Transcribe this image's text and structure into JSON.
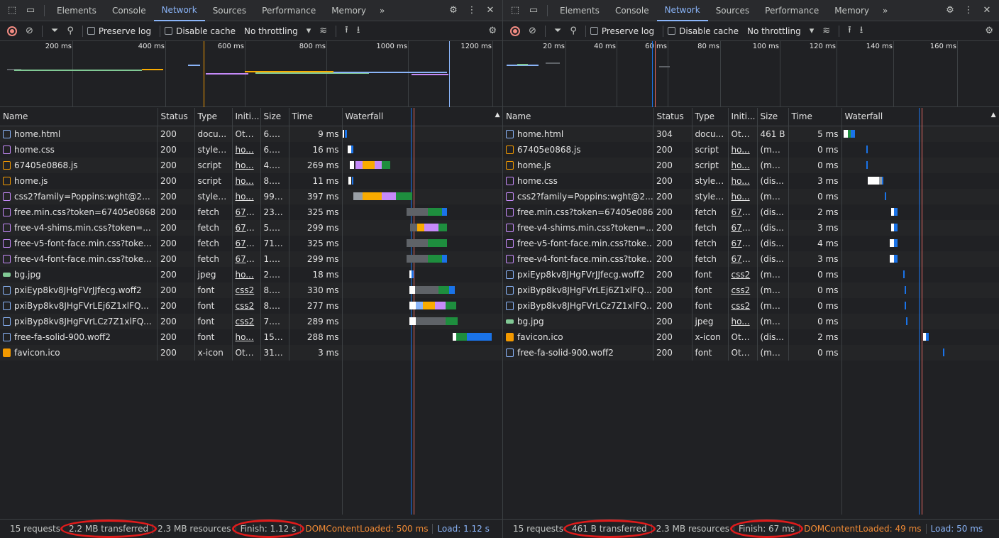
{
  "colors": {
    "accent": "#8ab4f8",
    "annotation": "#e01b1b",
    "dom_line": "#1a73e8",
    "load_line": "#e46962",
    "orange": "#f28b35"
  },
  "tabs": [
    "Elements",
    "Console",
    "Network",
    "Sources",
    "Performance",
    "Memory"
  ],
  "active_tab": "Network",
  "toolbar": {
    "preserve_log": "Preserve log",
    "disable_cache": "Disable cache",
    "throttling": "No throttling"
  },
  "columns": {
    "name": "Name",
    "status": "Status",
    "type": "Type",
    "initiator": "Initi...",
    "size": "Size",
    "time": "Time",
    "waterfall": "Waterfall"
  },
  "left": {
    "overview_ticks": [
      "200 ms",
      "400 ms",
      "600 ms",
      "800 ms",
      "1000 ms",
      "1200 ms"
    ],
    "rows": [
      {
        "name": "home.html",
        "icon": "document-icon",
        "status": "200",
        "type": "docu...",
        "initiator": "Other",
        "size": "6.3 ...",
        "time": "9 ms"
      },
      {
        "name": "home.css",
        "icon": "stylesheet-icon",
        "status": "200",
        "type": "styles...",
        "initiator": "ho...",
        "size": "6.1 ...",
        "time": "16 ms"
      },
      {
        "name": "67405e0868.js",
        "icon": "script-icon",
        "status": "200",
        "type": "script",
        "initiator": "ho...",
        "size": "4.7 ...",
        "time": "269 ms"
      },
      {
        "name": "home.js",
        "icon": "script-icon",
        "status": "200",
        "type": "script",
        "initiator": "ho...",
        "size": "8.5 ...",
        "time": "11 ms"
      },
      {
        "name": "css2?family=Poppins:wght@2...",
        "icon": "stylesheet-icon",
        "status": "200",
        "type": "styles...",
        "initiator": "ho...",
        "size": "991 B",
        "time": "397 ms"
      },
      {
        "name": "free.min.css?token=67405e0868",
        "icon": "stylesheet-icon",
        "status": "200",
        "type": "fetch",
        "initiator": "674...",
        "size": "23.8...",
        "time": "325 ms"
      },
      {
        "name": "free-v4-shims.min.css?token=...",
        "icon": "stylesheet-icon",
        "status": "200",
        "type": "fetch",
        "initiator": "674...",
        "size": "5.1 ...",
        "time": "299 ms"
      },
      {
        "name": "free-v5-font-face.min.css?toke...",
        "icon": "stylesheet-icon",
        "status": "200",
        "type": "fetch",
        "initiator": "674...",
        "size": "712 B",
        "time": "325 ms"
      },
      {
        "name": "free-v4-font-face.min.css?toke...",
        "icon": "stylesheet-icon",
        "status": "200",
        "type": "fetch",
        "initiator": "674...",
        "size": "1.0 ...",
        "time": "299 ms"
      },
      {
        "name": "bg.jpg",
        "icon": "image-icon",
        "status": "200",
        "type": "jpeg",
        "initiator": "ho...",
        "size": "2.0 ...",
        "time": "18 ms"
      },
      {
        "name": "pxiEyp8kv8JHgFVrJJfecg.woff2",
        "icon": "font-icon",
        "status": "200",
        "type": "font",
        "initiator": "css2",
        "size": "8.0 ...",
        "time": "330 ms"
      },
      {
        "name": "pxiByp8kv8JHgFVrLEj6Z1xlFQ...",
        "icon": "font-icon",
        "status": "200",
        "type": "font",
        "initiator": "css2",
        "size": "8.5 ...",
        "time": "277 ms"
      },
      {
        "name": "pxiByp8kv8JHgFVrLCz7Z1xlFQ...",
        "icon": "font-icon",
        "status": "200",
        "type": "font",
        "initiator": "css2",
        "size": "7.9 ...",
        "time": "289 ms"
      },
      {
        "name": "free-fa-solid-900.woff2",
        "icon": "font-icon",
        "status": "200",
        "type": "font",
        "initiator": "ho...",
        "size": "157...",
        "time": "288 ms"
      },
      {
        "name": "favicon.ico",
        "icon": "favicon-icon",
        "status": "200",
        "type": "x-icon",
        "initiator": "Other",
        "size": "31.4...",
        "time": "3 ms"
      }
    ],
    "status": {
      "requests": "15 requests",
      "transferred": "2.2 MB transferred",
      "resources": "2.3 MB resources",
      "finish": "Finish: 1.12 s",
      "dcl": "DOMContentLoaded: 500 ms",
      "load": "Load: 1.12 s"
    }
  },
  "right": {
    "overview_ticks": [
      "20 ms",
      "40 ms",
      "60 ms",
      "80 ms",
      "100 ms",
      "120 ms",
      "140 ms",
      "160 ms"
    ],
    "rows": [
      {
        "name": "home.html",
        "icon": "document-icon",
        "status": "304",
        "type": "docu...",
        "initiator": "Other",
        "size": "461 B",
        "time": "5 ms"
      },
      {
        "name": "67405e0868.js",
        "icon": "script-icon",
        "status": "200",
        "type": "script",
        "initiator": "ho...",
        "size": "(me...",
        "time": "0 ms"
      },
      {
        "name": "home.js",
        "icon": "script-icon",
        "status": "200",
        "type": "script",
        "initiator": "ho...",
        "size": "(me...",
        "time": "0 ms"
      },
      {
        "name": "home.css",
        "icon": "stylesheet-icon",
        "status": "200",
        "type": "styles...",
        "initiator": "ho...",
        "size": "(dis...",
        "time": "3 ms"
      },
      {
        "name": "css2?family=Poppins:wght@2...",
        "icon": "stylesheet-icon",
        "status": "200",
        "type": "styles...",
        "initiator": "ho...",
        "size": "(me...",
        "time": "0 ms"
      },
      {
        "name": "free.min.css?token=67405e0868",
        "icon": "stylesheet-icon",
        "status": "200",
        "type": "fetch",
        "initiator": "674...",
        "size": "(dis...",
        "time": "2 ms"
      },
      {
        "name": "free-v4-shims.min.css?token=...",
        "icon": "stylesheet-icon",
        "status": "200",
        "type": "fetch",
        "initiator": "674...",
        "size": "(dis...",
        "time": "3 ms"
      },
      {
        "name": "free-v5-font-face.min.css?toke...",
        "icon": "stylesheet-icon",
        "status": "200",
        "type": "fetch",
        "initiator": "674...",
        "size": "(dis...",
        "time": "4 ms"
      },
      {
        "name": "free-v4-font-face.min.css?toke...",
        "icon": "stylesheet-icon",
        "status": "200",
        "type": "fetch",
        "initiator": "674...",
        "size": "(dis...",
        "time": "3 ms"
      },
      {
        "name": "pxiEyp8kv8JHgFVrJJfecg.woff2",
        "icon": "font-icon",
        "status": "200",
        "type": "font",
        "initiator": "css2",
        "size": "(me...",
        "time": "0 ms"
      },
      {
        "name": "pxiByp8kv8JHgFVrLEj6Z1xlFQ...",
        "icon": "font-icon",
        "status": "200",
        "type": "font",
        "initiator": "css2",
        "size": "(me...",
        "time": "0 ms"
      },
      {
        "name": "pxiByp8kv8JHgFVrLCz7Z1xlFQ...",
        "icon": "font-icon",
        "status": "200",
        "type": "font",
        "initiator": "css2",
        "size": "(me...",
        "time": "0 ms"
      },
      {
        "name": "bg.jpg",
        "icon": "image-icon",
        "status": "200",
        "type": "jpeg",
        "initiator": "ho...",
        "size": "(me...",
        "time": "0 ms"
      },
      {
        "name": "favicon.ico",
        "icon": "favicon-icon",
        "status": "200",
        "type": "x-icon",
        "initiator": "Other",
        "size": "(dis...",
        "time": "2 ms"
      },
      {
        "name": "free-fa-solid-900.woff2",
        "icon": "font-icon",
        "status": "200",
        "type": "font",
        "initiator": "Other",
        "size": "(me...",
        "time": "0 ms"
      }
    ],
    "status": {
      "requests": "15 requests",
      "transferred": "461 B transferred",
      "resources": "2.3 MB resources",
      "finish": "Finish: 67 ms",
      "dcl": "DOMContentLoaded: 49 ms",
      "load": "Load: 50 ms"
    }
  }
}
